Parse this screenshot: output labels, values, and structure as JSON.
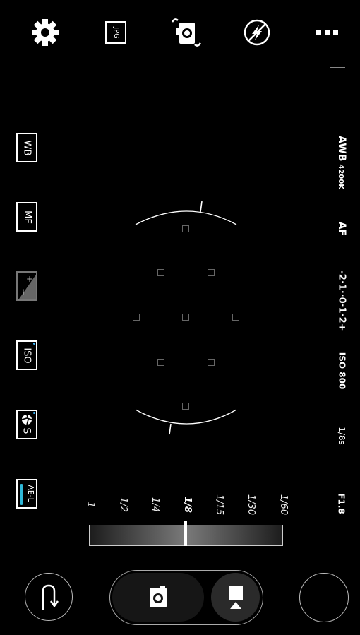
{
  "top_bar": {
    "format_label": "JPG"
  },
  "left_panel": {
    "wb_label": "WB",
    "mf_label": "MF",
    "exposure_plus": "+",
    "exposure_minus": "−",
    "iso_label": "ISO",
    "shutter_label": "S",
    "ael_label": "AE-L"
  },
  "right_status": {
    "awb": "AWB",
    "wb_temp": "4200K",
    "af": "AF",
    "ev_scale": "-2·1··0·1·2+",
    "iso": "ISO 800",
    "shutter": "1/8s",
    "aperture": "F1.8"
  },
  "shutter_scale": {
    "labels": [
      "1",
      "1/2",
      "1/4",
      "1/8",
      "1/15",
      "1/30",
      "1/60"
    ],
    "selected": "1/8"
  },
  "colors": {
    "accent": "#3ab8ff",
    "ael_toggle": "#2fb8d8",
    "background": "#000000"
  }
}
